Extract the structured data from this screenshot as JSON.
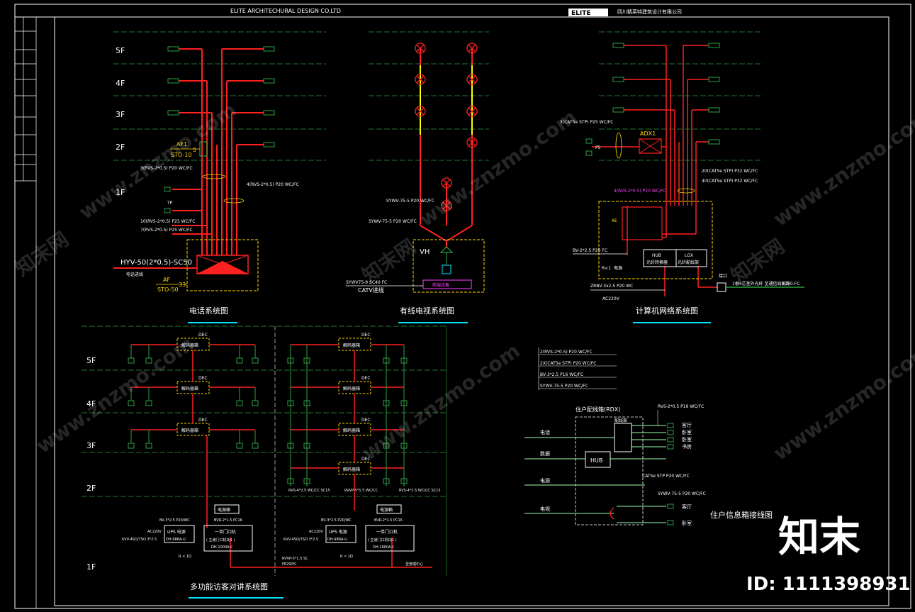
{
  "header": {
    "company_en": "ELITE  ARCHITECHURAL       DESIGN     CO.LTD",
    "logo_text": "ELITE",
    "company_cn": "四川精英特建筑设计有限公司"
  },
  "floors": [
    "5F",
    "4F",
    "3F",
    "2F",
    "1F"
  ],
  "telephone": {
    "title": "电话系统图",
    "af1": "AF1",
    "sto10": "STO-10",
    "five": "5",
    "cable1": "3(RVS-2*0.5) P20 WC/FC",
    "cable2": "4(RVS-2*0.5) P20 WC/FC",
    "cable3": "10(RVS-2*0.5) P25 WC/FC",
    "cable4": "7(RVS-2*0.5) P25 WC/FC",
    "main_cable": "HYV-50(2*0.5)-SC50",
    "main_note": "电话进线",
    "af": "AF",
    "sto50": "STO-50",
    "thirty3": "33",
    "outlet_label": "TP"
  },
  "catv": {
    "title": "有线电视系统图",
    "cable1": "SYWV-75-5 P20 WC/FC",
    "cable2": "SYWV-75-5 P20 WC/FC",
    "vh": "VH",
    "main_cable": "SYWV75-9 SC40 FC",
    "main_note": "CATV进线",
    "amp_label": "前端设备"
  },
  "network": {
    "title": "计算机网络系统图",
    "cable_top": "3(CAT5e STP) P25 WC/FC",
    "adx1": "ADX1",
    "p5": "P5",
    "cable_r1": "20(CAT5e STP) P32 WC/FC",
    "cable_r2": "40(CAT5e STP) P32 WC/FC",
    "cable_mag": "4(RVS-2*0.5) P20 WC/FC",
    "ae": "AE",
    "bv": "BV-2*2.5 P25 FC",
    "rk": "R<1",
    "hub": "HUB",
    "hub_sub": "光纤转换器",
    "lgx": "LGX",
    "lgx_sub": "光纤配线架",
    "zrbv": "ZRBV-3x2.5 P20 WC",
    "ac": "AC220V",
    "dz": "电源",
    "jk": "接口",
    "fiber": "1根4芯室外光纤\n至通信局机房",
    "sc50": "SC50-FC"
  },
  "intercom": {
    "title": "多功能访客对讲系统图",
    "dec": "DEC",
    "box": "解码器箱",
    "bottom_l": "RVS-4*2.5 WC/CC SC15",
    "bottom_m": "RVVP-5*1.5 WC/CC",
    "bottom_r": "RVS-4*2.5 WC/CC SC15",
    "power_box": "电源箱",
    "ups": "UPS  电源",
    "ups_model": "DH-988A-U",
    "main_unit": "一单门口机",
    "main_unit2": "( 主通门口机DJ1 )",
    "main_model": "DH-1000A-C",
    "ac220": "AC220V",
    "kvv": "KVV-4SO/7SO 3*2.5",
    "bv1": "BV-3*2.5 P20/WC",
    "bv2": "BVR-2*1.5 PC16",
    "rk": "R < 1Ω",
    "rvvp": "RVVP-5*1.5 SC",
    "pe": "PE20/FC",
    "to_center": "至管理中心"
  },
  "household": {
    "title": "住户信息箱接线图",
    "cable1": "2(RVS-2*0.5) P20 WC/FC",
    "cable2": "2X(CAT5e STP) P20 WC/FC",
    "cable3": "BV-3*2.5 P16 WC/FC",
    "cable4": "SYWV-75-5 P20 WC/FC",
    "box_title": "住户配线箱(RDX)",
    "patch": "配线架",
    "hub": "HUB",
    "rvs": "RVS-2*0.5 P16 WC/FC",
    "cat5e": "CAT5e STP P20 WC/FC",
    "sywv": "SYWV-75-5 P20 WC/FC",
    "left_labels": [
      "电话",
      "数据",
      "电源",
      "电视"
    ],
    "right_top": [
      "客厅",
      "卧室",
      "卧室",
      "书房"
    ],
    "right_bot": [
      "客厅",
      "卧室"
    ]
  },
  "watermark": {
    "brand": "知末",
    "id": "ID: 1111398931",
    "site": "www.znzmo.com",
    "cn": "知末网"
  }
}
